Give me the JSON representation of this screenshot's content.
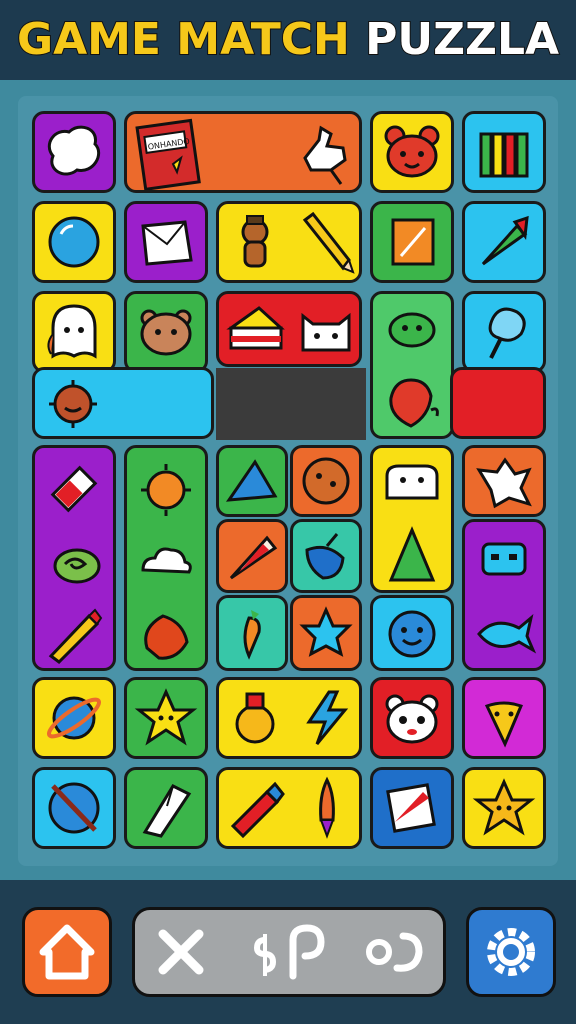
{
  "title": {
    "part1": "GAME MATCH",
    "part2": "PUZZLA"
  },
  "box_label": "ONHANDO",
  "colors": {
    "header_bg": "#1d3a4f",
    "board_bg": "#4a93a8",
    "purple": "#9b1fcb",
    "orange": "#ec6a2c",
    "yellow": "#f9df14",
    "cyan": "#2cc3ef",
    "green": "#3bb54a",
    "red": "#e21f26",
    "blue": "#1f6fc9",
    "teal": "#37c7a8",
    "magenta": "#d22ad6",
    "gray": "#a3a6a8"
  },
  "icons": [
    "cotton-icon",
    "cereal-box-icon",
    "hand-icon",
    "bear-face-icon",
    "letter-m-icon",
    "ball-icon",
    "folded-paper-icon",
    "gingerbread-icon",
    "pencil-icon",
    "notebook-icon",
    "carrot-icon",
    "ghost-icon",
    "bear-face-icon",
    "cake-slice-icon",
    "cat-face-icon",
    "turtle-icon",
    "cotton-candy-icon",
    "virus-icon",
    "cherry-icon",
    "eraser-icon",
    "sun-icon",
    "cone-icon",
    "cookie-icon",
    "sheep-icon",
    "star-shape-icon",
    "snail-icon",
    "cloud-icon",
    "pizza-icon",
    "scoop-icon",
    "tree-icon",
    "robot-face-icon",
    "pencil-icon",
    "blob-icon",
    "carrot-icon",
    "star-icon",
    "smiley-icon",
    "fish-icon",
    "planet-icon",
    "star-face-icon",
    "potion-icon",
    "lightning-icon",
    "panda-icon",
    "carrot-face-icon",
    "sword-icon",
    "crystal-icon",
    "glue-icon",
    "rocket-icon",
    "note-icon",
    "star-face-icon"
  ],
  "controls": {
    "home": "home-icon",
    "close": "close-icon",
    "coin": "coin-icon",
    "hint": "hint-icon",
    "undo": "undo-icon",
    "settings": "gear-icon"
  }
}
